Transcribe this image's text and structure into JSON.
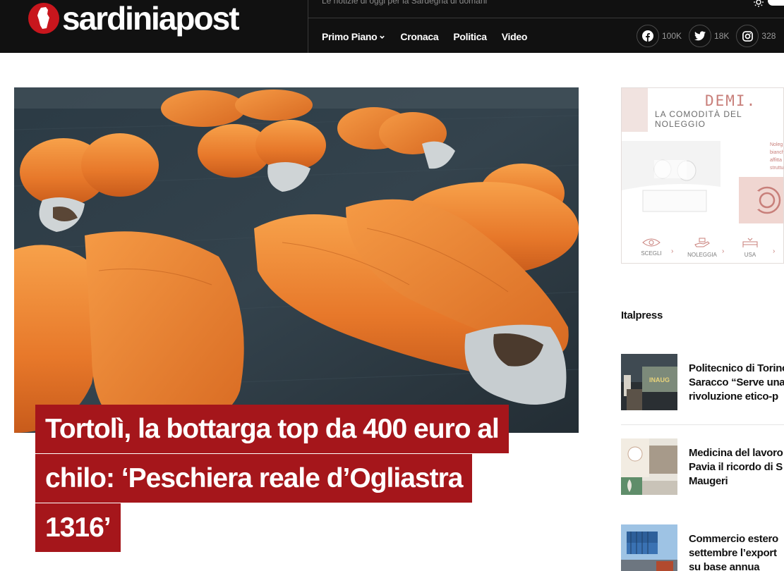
{
  "site": {
    "logo_text": "sardiniapost",
    "tagline": "Le notizie di oggi per la Sardegna di domani"
  },
  "nav": {
    "items": [
      {
        "label": "Primo Piano",
        "has_dropdown": true
      },
      {
        "label": "Cronaca"
      },
      {
        "label": "Politica"
      },
      {
        "label": "Video"
      }
    ]
  },
  "socials": [
    {
      "icon": "facebook-icon",
      "count": "100K"
    },
    {
      "icon": "twitter-icon",
      "count": "18K"
    },
    {
      "icon": "instagram-icon",
      "count": "328"
    }
  ],
  "article": {
    "headline_lines": [
      "Tortolì, la bottarga top da 400 euro al",
      "chilo: ‘Peschiera reale d’Ogliastra",
      "1316’"
    ]
  },
  "ad": {
    "brand": "DEMI.",
    "subtitle": "LA COMODITÀ DEL NOLEGGIO",
    "side_text": [
      "Noleg",
      "bianch",
      "affitta",
      "struttu"
    ],
    "steps": [
      "SCEGLI",
      "NOLEGGIA",
      "USA"
    ]
  },
  "sidebar": {
    "section_title": "Italpress",
    "news": [
      {
        "title": "Politecnico di Torino\nSaracco “Serve una\nrivoluzione etico-p"
      },
      {
        "title": "Medicina del lavoro\nPavia il ricordo di S\nMaugeri"
      },
      {
        "title": "Commercio estero\nsettembre l’export\nsu base annua"
      }
    ]
  },
  "colors": {
    "header_bg": "#111111",
    "accent_red": "#a5161b",
    "ad_accent": "#c87f7a"
  }
}
